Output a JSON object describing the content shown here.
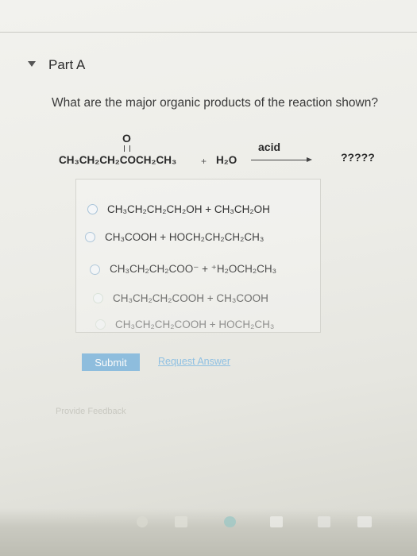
{
  "part": {
    "title": "Part A"
  },
  "question": {
    "text": "What are the major organic products of the reaction shown?"
  },
  "reaction": {
    "carbonyl_oxygen": "O",
    "reactant": "CH₃CH₂CH₂COCH₂CH₃",
    "plus": "+",
    "reagent": "H₂O",
    "condition": "acid",
    "product": "?????"
  },
  "choices": [
    {
      "label": "CH₃CH₂CH₂CH₂OH + CH₃CH₂OH"
    },
    {
      "label": "CH₃COOH + HOCH₂CH₂CH₂CH₃"
    },
    {
      "label": "CH₃CH₂CH₂COO⁻ + ⁺H₂OCH₂CH₃"
    },
    {
      "label": "CH₃CH₂CH₂COOH + CH₃COOH"
    },
    {
      "label": "CH₃CH₂CH₂COOH + HOCH₂CH₃"
    }
  ],
  "actions": {
    "submit": "Submit",
    "request_answer": "Request Answer"
  },
  "footer": {
    "feedback": "Provide Feedback"
  }
}
